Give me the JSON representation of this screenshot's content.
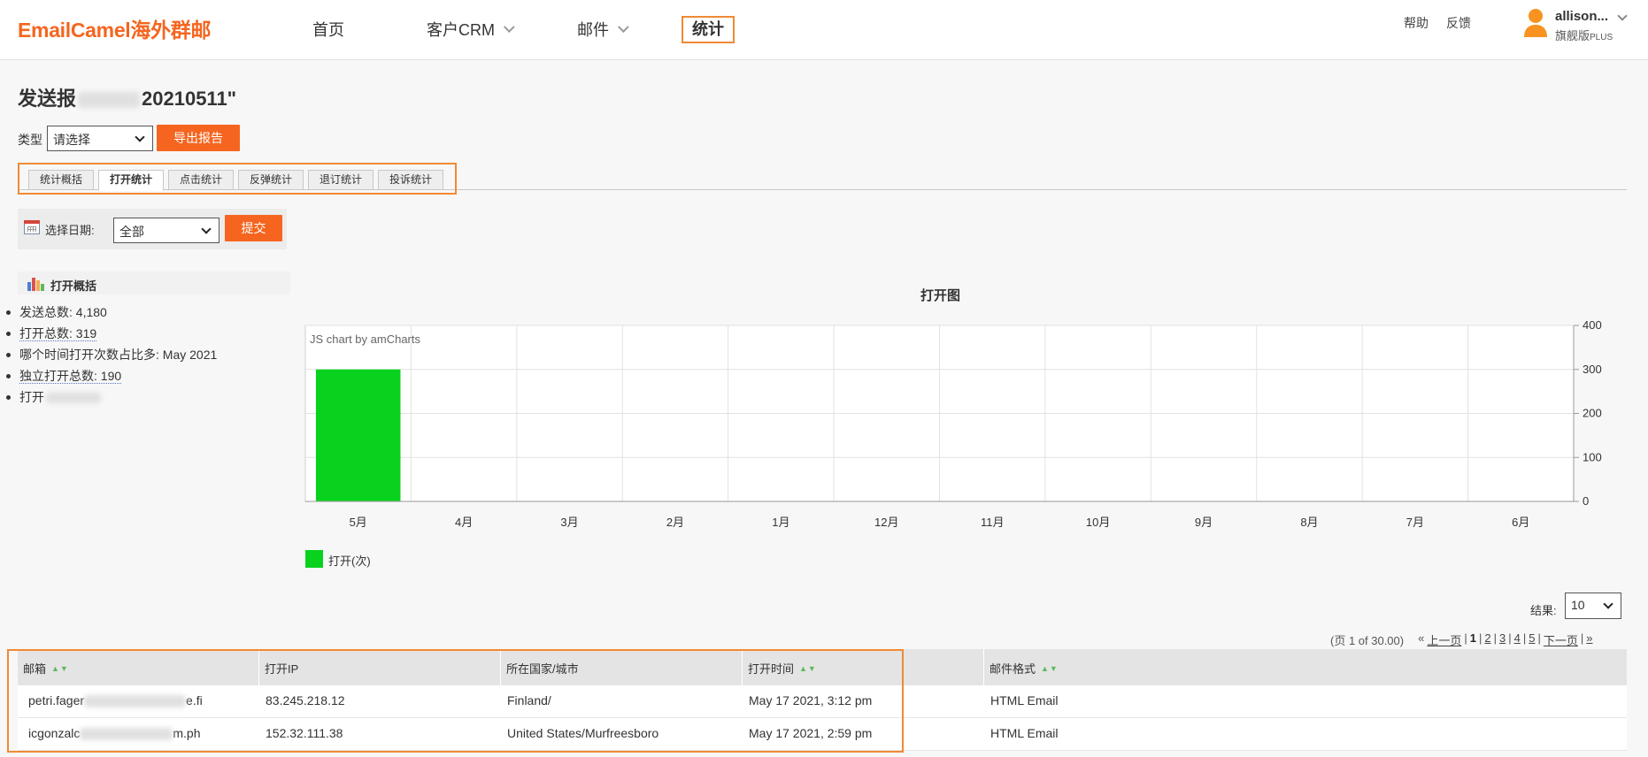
{
  "header": {
    "logo": "EmailCamel海外群邮",
    "nav": [
      {
        "label": "首页"
      },
      {
        "label": "客户CRM"
      },
      {
        "label": "邮件"
      },
      {
        "label": "统计"
      }
    ],
    "help": "帮助",
    "feedback": "反馈",
    "user_name": "allison...",
    "user_plan": "旗舰版",
    "user_plan_suffix": "PLUS"
  },
  "page": {
    "title_prefix": "发送报",
    "title_suffix": "20210511\""
  },
  "type_filter": {
    "label": "类型",
    "value": "请选择",
    "export_label": "导出报告"
  },
  "tabs": [
    {
      "label": "统计概括"
    },
    {
      "label": "打开统计"
    },
    {
      "label": "点击统计"
    },
    {
      "label": "反弹统计"
    },
    {
      "label": "退订统计"
    },
    {
      "label": "投诉统计"
    }
  ],
  "date_filter": {
    "label": "选择日期:",
    "value": "全部",
    "submit_label": "提交"
  },
  "summary": {
    "heading": "打开概括",
    "items": [
      {
        "text": "发送总数: 4,180"
      },
      {
        "text": "打开总数: 319"
      },
      {
        "text": "哪个时间打开次数占比多: May 2021"
      },
      {
        "text": "独立打开总数: 190"
      },
      {
        "text": "打开"
      }
    ]
  },
  "chart_credit": "JS chart by amCharts",
  "chart_data": {
    "type": "bar",
    "title": "打开图",
    "categories": [
      "5月",
      "4月",
      "3月",
      "2月",
      "1月",
      "12月",
      "11月",
      "10月",
      "9月",
      "8月",
      "7月",
      "6月"
    ],
    "series": [
      {
        "name": "打开(次)",
        "values": [
          300,
          0,
          0,
          0,
          0,
          0,
          0,
          0,
          0,
          0,
          0,
          0
        ],
        "color": "#09d21f"
      }
    ],
    "yticks": [
      0,
      100,
      200,
      300,
      400
    ],
    "ylim": [
      0,
      400
    ],
    "y_axis_side": "right",
    "grid": true,
    "legend": "bottom-left"
  },
  "results": {
    "label": "结果:",
    "value": "10"
  },
  "pagination": {
    "info": "(页 1 of 30.00)",
    "first": "«",
    "prev": "上一页",
    "current": "1",
    "pages": [
      "2",
      "3",
      "4",
      "5"
    ],
    "next": "下一页",
    "last": "»",
    "sep": "|"
  },
  "table": {
    "columns": [
      "邮箱",
      "打开IP",
      "所在国家/城市",
      "打开时间",
      "邮件格式"
    ],
    "rows": [
      {
        "email_start": "petri.fager",
        "email_end": "e.fi",
        "ip": "83.245.218.12",
        "location": "Finland/",
        "time": "May 17 2021, 3:12 pm",
        "format": "HTML Email"
      },
      {
        "email_start": "icgonzalc",
        "email_end": "m.ph",
        "ip": "152.32.111.38",
        "location": "United States/Murfreesboro",
        "time": "May 17 2021, 2:59 pm",
        "format": "HTML Email"
      }
    ]
  },
  "colors": {
    "brand": "#f5651f",
    "highlight_outline": "#f08a35",
    "bar": "#09d21f"
  }
}
